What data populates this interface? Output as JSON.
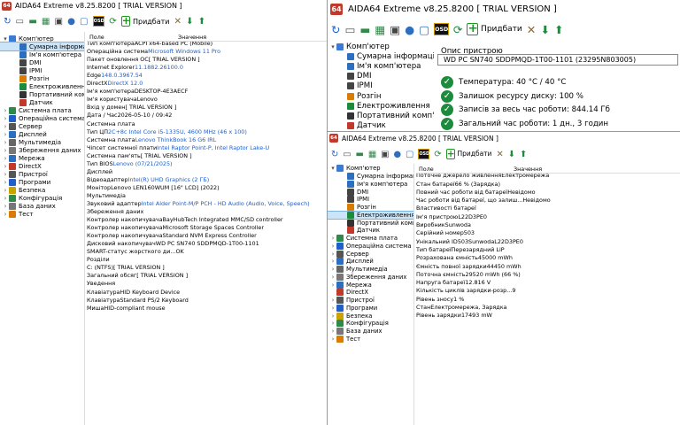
{
  "app": {
    "title": "AIDA64 Extreme v8.25.8200  [ TRIAL VERSION ]",
    "icon": "64",
    "add_label": "Придбати"
  },
  "colors": {
    "accent": "#1f5fc8",
    "ok": "#1c8c3c",
    "app_icon": "#c0392b",
    "selection": "#cce4f7"
  },
  "icons": [
    "refresh-icon",
    "report-icon",
    "memory-icon",
    "motherboard-icon",
    "chip-icon",
    "user-icon",
    "screen-icon",
    "osd-icon",
    "update-icon",
    "add-icon",
    "tools-icon",
    "down-arrow-icon",
    "up-arrow-icon"
  ],
  "left": {
    "tree": [
      {
        "label": "Комп'ютер",
        "level": 0,
        "expander": "▾",
        "icon": "#3a7bd5"
      },
      {
        "label": "Сумарна інформація",
        "level": 1,
        "expander": "",
        "icon": "#2c6fc0",
        "selected": true
      },
      {
        "label": "Ім'я комп'ютера",
        "level": 1,
        "expander": "",
        "icon": "#2c6fc0"
      },
      {
        "label": "DMI",
        "level": 1,
        "expander": "",
        "icon": "#444"
      },
      {
        "label": "IPMI",
        "level": 1,
        "expander": "",
        "icon": "#444"
      },
      {
        "label": "Розгін",
        "level": 1,
        "expander": "",
        "icon": "#d97c00"
      },
      {
        "label": "Електроживлення",
        "level": 1,
        "expander": "",
        "icon": "#1c8c3c"
      },
      {
        "label": "Портативний комп'ютер",
        "level": 1,
        "expander": "",
        "icon": "#333"
      },
      {
        "label": "Датчик",
        "level": 1,
        "expander": "",
        "icon": "#c0392b"
      },
      {
        "label": "Системна плата",
        "level": 0,
        "expander": "›",
        "icon": "#2f8a4a"
      },
      {
        "label": "Операційна система",
        "level": 0,
        "expander": "›",
        "icon": "#1f5fc8"
      },
      {
        "label": "Сервер",
        "level": 0,
        "expander": "›",
        "icon": "#555"
      },
      {
        "label": "Дисплей",
        "level": 0,
        "expander": "›",
        "icon": "#2c6fc0"
      },
      {
        "label": "Мультимедіа",
        "level": 0,
        "expander": "›",
        "icon": "#666"
      },
      {
        "label": "Збереження даних",
        "level": 0,
        "expander": "›",
        "icon": "#777"
      },
      {
        "label": "Мережа",
        "level": 0,
        "expander": "›",
        "icon": "#2c6fc0"
      },
      {
        "label": "DirectX",
        "level": 0,
        "expander": "›",
        "icon": "#c0392b"
      },
      {
        "label": "Пристрої",
        "level": 0,
        "expander": "›",
        "icon": "#555"
      },
      {
        "label": "Програми",
        "level": 0,
        "expander": "›",
        "icon": "#1f5fc8"
      },
      {
        "label": "Безпека",
        "level": 0,
        "expander": "›",
        "icon": "#c9a400"
      },
      {
        "label": "Конфігурація",
        "level": 0,
        "expander": "›",
        "icon": "#2f8a4a"
      },
      {
        "label": "База даних",
        "level": 0,
        "expander": "›",
        "icon": "#777"
      },
      {
        "label": "Тест",
        "level": 0,
        "expander": "›",
        "icon": "#d97c00"
      }
    ],
    "header": {
      "field": "Поле",
      "value": "Значення"
    },
    "rows": [
      {
        "t": "s",
        "f": "Комп'ютер"
      },
      {
        "f": "Тип комп'ютера",
        "v": "ACPI x64-based PC  (Mobile)"
      },
      {
        "f": "Операційна система",
        "v": "Microsoft Windows 11 Pro",
        "link": true
      },
      {
        "f": "Пакет оновлення ОС",
        "v": "[ TRIAL VERSION ]"
      },
      {
        "f": "Internet Explorer",
        "v": "11.1882.26100.0",
        "link": true
      },
      {
        "f": "Edge",
        "v": "148.0.3967.54",
        "link": true
      },
      {
        "f": "DirectX",
        "v": "DirectX 12.0",
        "link": true
      },
      {
        "f": "Ім'я комп'ютера",
        "v": "DESKTOP-4E3AECF"
      },
      {
        "f": "Ім'я користувача",
        "v": "Lenovo"
      },
      {
        "f": "Вхід у домен",
        "v": "[ TRIAL VERSION ]"
      },
      {
        "f": "Дата / Час",
        "v": "2026-05-10 / 09:42"
      },
      {
        "t": "g"
      },
      {
        "t": "s",
        "f": "Системна плата"
      },
      {
        "f": "Тип ЦП",
        "v": "2C+8c Intel Core i5-1335U, 4600 MHz (46 x 100)",
        "link": true
      },
      {
        "f": "Системна плата",
        "v": "Lenovo ThinkBook 16 G6 IRL",
        "link": true
      },
      {
        "f": "Чіпсет системної плати",
        "v": "Intel Raptor Point-P, Intel Raptor Lake-U",
        "link": true
      },
      {
        "f": "Системна пам'ять",
        "v": "[ TRIAL VERSION ]"
      },
      {
        "f": "Тип BIOS",
        "v": "Lenovo (07/21/2025)",
        "link": true
      },
      {
        "t": "g"
      },
      {
        "t": "s",
        "f": "Дисплей"
      },
      {
        "f": "Відеоадаптер",
        "v": "Intel(R) UHD Graphics  (2 ГБ)",
        "link": true
      },
      {
        "f": "Монітор",
        "v": "Lenovo LEN160WUM  [16\" LCD]  (2022)"
      },
      {
        "t": "g"
      },
      {
        "t": "s",
        "f": "Мультимедіа"
      },
      {
        "f": "Звуковий адаптер",
        "v": "Intel Alder Point-M/P PCH - HD Audio (Audio, Voice, Speech)",
        "link": true
      },
      {
        "t": "g"
      },
      {
        "t": "s",
        "f": "Збереження даних"
      },
      {
        "f": "Контролер накопичувача",
        "v": "BayHubTech Integrated MMC/SD controller"
      },
      {
        "f": "Контролер накопичувача",
        "v": "Microsoft Storage Spaces Controller"
      },
      {
        "f": "Контролер накопичувача",
        "v": "Standard NVM Express Controller"
      },
      {
        "f": "Дисковий накопичувач",
        "v": "WD PC SN740 SDDPMQD-1T00-1101"
      },
      {
        "f": "SMART-статус жорсткого ди...",
        "v": "OK"
      },
      {
        "t": "g"
      },
      {
        "t": "s",
        "f": "Розділи"
      },
      {
        "f": "C: (NTFS)",
        "v": "[ TRIAL VERSION ]"
      },
      {
        "f": "Загальний обсяг",
        "v": "[ TRIAL VERSION ]"
      },
      {
        "t": "g"
      },
      {
        "t": "s",
        "f": "Уведення"
      },
      {
        "f": "Клавіатура",
        "v": "HID Keyboard Device"
      },
      {
        "f": "Клавіатура",
        "v": "Standard PS/2 Keyboard"
      },
      {
        "f": "Миша",
        "v": "HID-compliant mouse"
      }
    ]
  },
  "tr": {
    "tree": [
      {
        "label": "Комп'ютер",
        "level": 0,
        "expander": "▾",
        "icon": "#3a7bd5"
      },
      {
        "label": "Сумарна інформація",
        "level": 1,
        "expander": "",
        "icon": "#2c6fc0"
      },
      {
        "label": "Ім'я комп'ютера",
        "level": 1,
        "expander": "",
        "icon": "#2c6fc0"
      },
      {
        "label": "DMI",
        "level": 1,
        "expander": "",
        "icon": "#444"
      },
      {
        "label": "IPMI",
        "level": 1,
        "expander": "",
        "icon": "#444"
      },
      {
        "label": "Розгін",
        "level": 1,
        "expander": "",
        "icon": "#d97c00"
      },
      {
        "label": "Електроживлення",
        "level": 1,
        "expander": "",
        "icon": "#1c8c3c"
      },
      {
        "label": "Портативний комп'ютер",
        "level": 1,
        "expander": "",
        "icon": "#333"
      },
      {
        "label": "Датчик",
        "level": 1,
        "expander": "",
        "icon": "#c0392b"
      }
    ],
    "device_label": "Опис пристрою",
    "device_value": "WD PC SN740 SDDPMQD-1T00-1101 (23295N803005)",
    "status": [
      "Температура: 40 °C / 40 °C",
      "Залишок ресурсу диску: 100 %",
      "Записів за весь час роботи: 844.14 Гб",
      "Загальний час роботи: 1 дн., 3 годин"
    ]
  },
  "br": {
    "tree": [
      {
        "label": "Комп'ютер",
        "level": 0,
        "expander": "▾",
        "icon": "#3a7bd5"
      },
      {
        "label": "Сумарна інформація",
        "level": 1,
        "expander": "",
        "icon": "#2c6fc0"
      },
      {
        "label": "Ім'я комп'ютера",
        "level": 1,
        "expander": "",
        "icon": "#2c6fc0"
      },
      {
        "label": "DMI",
        "level": 1,
        "expander": "",
        "icon": "#444"
      },
      {
        "label": "IPMI",
        "level": 1,
        "expander": "",
        "icon": "#444"
      },
      {
        "label": "Розгін",
        "level": 1,
        "expander": "",
        "icon": "#d97c00"
      },
      {
        "label": "Електроживлення",
        "level": 1,
        "expander": "",
        "icon": "#1c8c3c",
        "selected": true
      },
      {
        "label": "Портативний комп'ютер",
        "level": 1,
        "expander": "",
        "icon": "#333"
      },
      {
        "label": "Датчик",
        "level": 1,
        "expander": "",
        "icon": "#c0392b"
      },
      {
        "label": "Системна плата",
        "level": 0,
        "expander": "›",
        "icon": "#2f8a4a"
      },
      {
        "label": "Операційна система",
        "level": 0,
        "expander": "›",
        "icon": "#1f5fc8"
      },
      {
        "label": "Сервер",
        "level": 0,
        "expander": "›",
        "icon": "#555"
      },
      {
        "label": "Дисплей",
        "level": 0,
        "expander": "›",
        "icon": "#2c6fc0"
      },
      {
        "label": "Мультимедіа",
        "level": 0,
        "expander": "›",
        "icon": "#666"
      },
      {
        "label": "Збереження даних",
        "level": 0,
        "expander": "›",
        "icon": "#777"
      },
      {
        "label": "Мережа",
        "level": 0,
        "expander": "›",
        "icon": "#2c6fc0"
      },
      {
        "label": "DirectX",
        "level": 0,
        "expander": "",
        "icon": "#c0392b"
      },
      {
        "label": "Пристрої",
        "level": 0,
        "expander": "›",
        "icon": "#555"
      },
      {
        "label": "Програми",
        "level": 0,
        "expander": "›",
        "icon": "#1f5fc8"
      },
      {
        "label": "Безпека",
        "level": 0,
        "expander": "›",
        "icon": "#c9a400"
      },
      {
        "label": "Конфігурація",
        "level": 0,
        "expander": "›",
        "icon": "#2f8a4a"
      },
      {
        "label": "База даних",
        "level": 0,
        "expander": "›",
        "icon": "#777"
      },
      {
        "label": "Тест",
        "level": 0,
        "expander": "›",
        "icon": "#d97c00"
      }
    ],
    "header": {
      "field": "Поле",
      "value": "Значення"
    },
    "rows": [
      {
        "t": "s",
        "f": "Властивості електроживлення"
      },
      {
        "f": "Поточне джерело живлення",
        "v": "Електромережа"
      },
      {
        "f": "Стан батареї",
        "v": "66 % (Зарядка)"
      },
      {
        "f": "Повний час роботи від батареї",
        "v": "Невідомо"
      },
      {
        "f": "Час роботи від батареї, що залиш...",
        "v": "Невідомо"
      },
      {
        "t": "g"
      },
      {
        "t": "s",
        "f": "Властивості батареї"
      },
      {
        "f": "Ім'я пристрою",
        "v": "L22D3PE0"
      },
      {
        "f": "Виробник",
        "v": "Sunwoda"
      },
      {
        "f": "Серійний номер",
        "v": "503"
      },
      {
        "f": "Унікальний ID",
        "v": "503SunwodaL22D3PE0"
      },
      {
        "f": "Тип батареї",
        "v": "Перезарядний LiP"
      },
      {
        "f": "Розрахована ємність",
        "v": "45000 mWh"
      },
      {
        "f": "Ємність повної зарядки",
        "v": "44450 mWh"
      },
      {
        "f": "Поточна ємність",
        "v": "29520 mWh  (66 %)"
      },
      {
        "f": "Напруга батареї",
        "v": "12.816 V"
      },
      {
        "f": "Кількість циклів зарядки-розр...",
        "v": "9"
      },
      {
        "f": "Рівень зносу",
        "v": "1 %"
      },
      {
        "f": "Стан",
        "v": "Електромережа, Зарядка"
      },
      {
        "f": "Рівень зарядки",
        "v": "17493 mW"
      }
    ]
  }
}
